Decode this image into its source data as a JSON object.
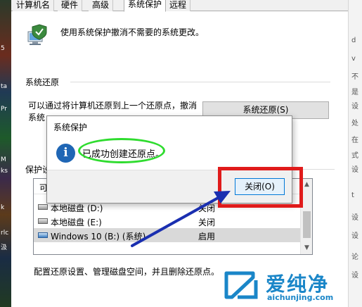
{
  "tabs": [
    {
      "label": "计算机名"
    },
    {
      "label": "硬件"
    },
    {
      "label": "高级"
    },
    {
      "label": "系统保护"
    },
    {
      "label": "远程"
    }
  ],
  "header": {
    "description": "使用系统保护撤消不需要的系统更改。"
  },
  "restore_group": {
    "title": "系统还原",
    "text": "可以通过将计算机还原到上一个还原点，撤消系统",
    "button_label": "系统还原(S)"
  },
  "protection_group": {
    "title": "保护设"
  },
  "drive_list": {
    "header_label": "可",
    "rows": [
      {
        "name": "本地磁盘 (D:)",
        "status": "关闭"
      },
      {
        "name": "本地磁盘 (E:)",
        "status": "关闭"
      },
      {
        "name": "Windows 10 (B:) (系统)",
        "status": "启用"
      }
    ]
  },
  "config_text": "配置还原设置、管理磁盘空间，并且删除还原点。",
  "message_box": {
    "title": "系统保护",
    "message": "已成功创建还原点。",
    "close_label": "关闭(O)"
  },
  "watermark": {
    "brand": "爱纯净",
    "url": "aichunjing.com"
  },
  "annotation_colors": {
    "highlight_ellipse": "#2fdc2f",
    "highlight_box": "#e01b1b",
    "arrow": "#1a2fb0"
  },
  "side_text": {
    "left": [
      "5",
      "ta",
      "Pr",
      "M",
      "ks",
      "k",
      "rlc",
      "汲"
    ],
    "right": [
      "d",
      "v",
      "不",
      "是",
      "设",
      "处",
      "在",
      "式",
      "设",
      "t",
      "设",
      "设",
      "论",
      "设"
    ]
  }
}
